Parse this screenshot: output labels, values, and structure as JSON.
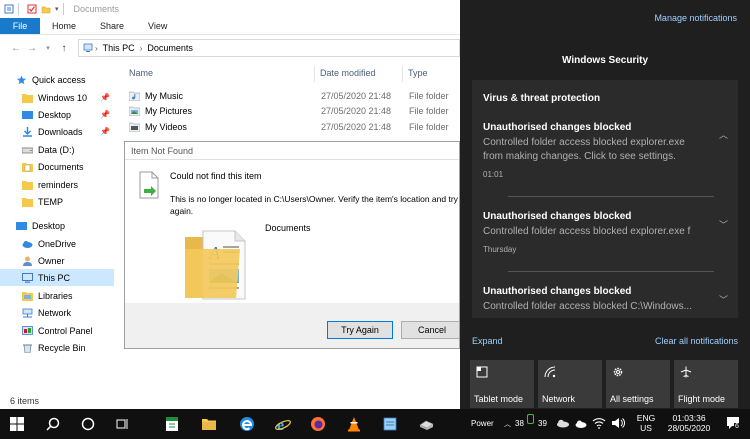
{
  "explorer": {
    "title": "Documents",
    "ribbon_tabs": [
      "File",
      "Home",
      "Share",
      "View"
    ],
    "address": {
      "crumbs": [
        "This PC",
        "Documents"
      ]
    },
    "nav": [
      {
        "label": "Quick access",
        "icon": "star-icon"
      },
      {
        "label": "Windows 10",
        "icon": "folder-icon",
        "pinned": true
      },
      {
        "label": "Desktop",
        "icon": "desktop-folder-icon",
        "pinned": true
      },
      {
        "label": "Downloads",
        "icon": "download-icon",
        "pinned": true
      },
      {
        "label": "Data (D:)",
        "icon": "drive-icon"
      },
      {
        "label": "Documents",
        "icon": "documents-icon"
      },
      {
        "label": "reminders",
        "icon": "folder-icon"
      },
      {
        "label": "TEMP",
        "icon": "folder-icon"
      },
      {
        "label": "Desktop",
        "icon": "desktop-icon"
      },
      {
        "label": "OneDrive",
        "icon": "cloud-icon"
      },
      {
        "label": "Owner",
        "icon": "user-icon"
      },
      {
        "label": "This PC",
        "icon": "computer-icon",
        "selected": true
      },
      {
        "label": "Libraries",
        "icon": "libraries-icon"
      },
      {
        "label": "Network",
        "icon": "network-icon"
      },
      {
        "label": "Control Panel",
        "icon": "control-panel-icon"
      },
      {
        "label": "Recycle Bin",
        "icon": "recycle-bin-icon"
      }
    ],
    "columns": {
      "name": "Name",
      "date": "Date modified",
      "type": "Type"
    },
    "files": [
      {
        "name": "My Music",
        "date": "27/05/2020 21:48",
        "type": "File folder",
        "icon": "music-folder-icon"
      },
      {
        "name": "My Pictures",
        "date": "27/05/2020 21:48",
        "type": "File folder",
        "icon": "pictures-folder-icon"
      },
      {
        "name": "My Videos",
        "date": "27/05/2020 21:48",
        "type": "File folder",
        "icon": "videos-folder-icon"
      }
    ],
    "status": "6 items"
  },
  "dialog": {
    "title": "Item Not Found",
    "heading": "Could not find this item",
    "message": "This is no longer located in C:\\Users\\Owner. Verify the item's location and try again.",
    "item_name": "Documents",
    "try_again": "Try Again",
    "cancel": "Cancel"
  },
  "action_center": {
    "manage": "Manage notifications",
    "group_title": "Windows Security",
    "card_header": "Virus & threat protection",
    "notifications": [
      {
        "title": "Unauthorised changes blocked",
        "body": [
          "Controlled folder access blocked explorer.exe",
          "from making changes. Click to see settings."
        ],
        "time": "01:01",
        "chevron": "^"
      },
      {
        "title": "Unauthorised changes blocked",
        "body": [
          "Controlled folder access blocked explorer.exe f"
        ],
        "time": "Thursday",
        "chevron": "v"
      },
      {
        "title": "Unauthorised changes blocked",
        "body": [
          "Controlled folder access blocked C:\\Windows..."
        ],
        "time": "",
        "chevron": "v"
      }
    ],
    "expand": "Expand",
    "clear_all": "Clear all notifications",
    "quick_actions": [
      {
        "label": "Tablet mode",
        "icon": "tablet-mode-icon"
      },
      {
        "label": "Network",
        "icon": "network-icon"
      },
      {
        "label": "All settings",
        "icon": "gear-icon"
      },
      {
        "label": "Flight mode",
        "icon": "airplane-icon"
      }
    ]
  },
  "taskbar": {
    "power_label": "Power",
    "tray_numbers": [
      "38",
      "39"
    ],
    "lang": "ENG",
    "region": "US",
    "time": "01:03:36",
    "date": "28/05/2020",
    "notif_count": "6"
  },
  "colors": {
    "file_tab": "#1979ca",
    "selection": "#cce8ff",
    "action_center_bg": "#1f1f1f",
    "link": "#9fd0ff",
    "taskbar": "#101010"
  }
}
